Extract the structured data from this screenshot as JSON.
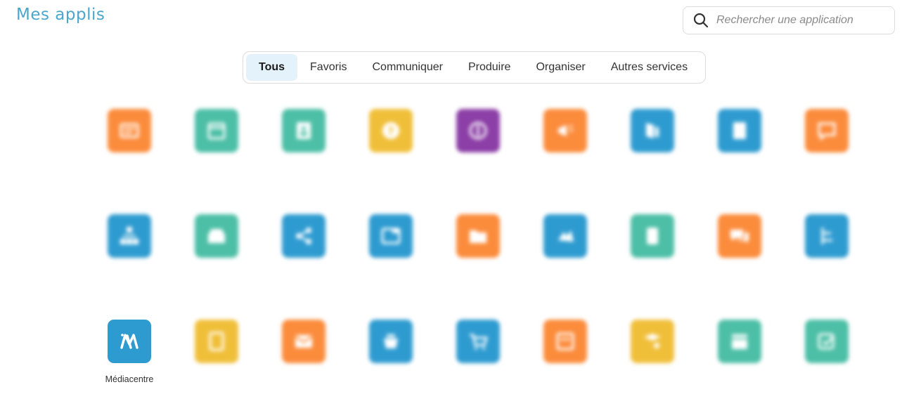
{
  "header": {
    "title": "Mes applis"
  },
  "search": {
    "placeholder": "Rechercher une application",
    "icon": "search-icon"
  },
  "tabs": [
    {
      "label": "Tous",
      "active": true
    },
    {
      "label": "Favoris",
      "active": false
    },
    {
      "label": "Communiquer",
      "active": false
    },
    {
      "label": "Produire",
      "active": false
    },
    {
      "label": "Organiser",
      "active": false
    },
    {
      "label": "Autres services",
      "active": false
    }
  ],
  "colors": {
    "orange": "#fb8c3c",
    "teal": "#4dbfa6",
    "yellow": "#f0bf3a",
    "purple": "#8c3fa6",
    "blue": "#2e9bd0",
    "title": "#4aa6cc",
    "active_tab_bg": "#e4f2fb"
  },
  "apps": [
    {
      "label": "",
      "color": "#fb8c3c",
      "icon": "news-icon",
      "blurred": true
    },
    {
      "label": "",
      "color": "#4dbfa6",
      "icon": "calendar-icon",
      "blurred": true
    },
    {
      "label": "",
      "color": "#4dbfa6",
      "icon": "contacts-icon",
      "blurred": true
    },
    {
      "label": "",
      "color": "#f0bf3a",
      "icon": "help-icon",
      "blurred": true
    },
    {
      "label": "",
      "color": "#8c3fa6",
      "icon": "library-icon",
      "blurred": true
    },
    {
      "label": "",
      "color": "#fb8c3c",
      "icon": "megaphone-icon",
      "blurred": true
    },
    {
      "label": "",
      "color": "#2e9bd0",
      "icon": "book-icon",
      "blurred": true
    },
    {
      "label": "",
      "color": "#2e9bd0",
      "icon": "notebook-icon",
      "blurred": true
    },
    {
      "label": "",
      "color": "#fb8c3c",
      "icon": "chat-bubble-icon",
      "blurred": true
    },
    {
      "label": "",
      "color": "#2e9bd0",
      "icon": "mindmap-icon",
      "blurred": true
    },
    {
      "label": "",
      "color": "#4dbfa6",
      "icon": "inbox-icon",
      "blurred": true
    },
    {
      "label": "",
      "color": "#2e9bd0",
      "icon": "share-icon",
      "blurred": true
    },
    {
      "label": "",
      "color": "#2e9bd0",
      "icon": "courses-icon",
      "blurred": true
    },
    {
      "label": "",
      "color": "#fb8c3c",
      "icon": "folder-icon",
      "blurred": true
    },
    {
      "label": "",
      "color": "#2e9bd0",
      "icon": "exercises-icon",
      "blurred": true
    },
    {
      "label": "",
      "color": "#4dbfa6",
      "icon": "form-icon",
      "blurred": true
    },
    {
      "label": "",
      "color": "#fb8c3c",
      "icon": "forum-icon",
      "blurred": true
    },
    {
      "label": "",
      "color": "#2e9bd0",
      "icon": "timeline-icon",
      "blurred": true
    },
    {
      "label": "Médiacentre",
      "color": "#2e9bd0",
      "icon": "mediacentre-icon",
      "blurred": false
    },
    {
      "label": "",
      "color": "#f0bf3a",
      "icon": "documents-icon",
      "blurred": true
    },
    {
      "label": "",
      "color": "#fb8c3c",
      "icon": "mail-icon",
      "blurred": true
    },
    {
      "label": "",
      "color": "#2e9bd0",
      "icon": "basket-icon",
      "blurred": true
    },
    {
      "label": "",
      "color": "#2e9bd0",
      "icon": "cart-icon",
      "blurred": true
    },
    {
      "label": "",
      "color": "#fb8c3c",
      "icon": "pages-icon",
      "blurred": true
    },
    {
      "label": "",
      "color": "#f0bf3a",
      "icon": "class-settings-icon",
      "blurred": true
    },
    {
      "label": "",
      "color": "#4dbfa6",
      "icon": "booking-icon",
      "blurred": true
    },
    {
      "label": "",
      "color": "#4dbfa6",
      "icon": "poll-icon",
      "blurred": true
    }
  ]
}
